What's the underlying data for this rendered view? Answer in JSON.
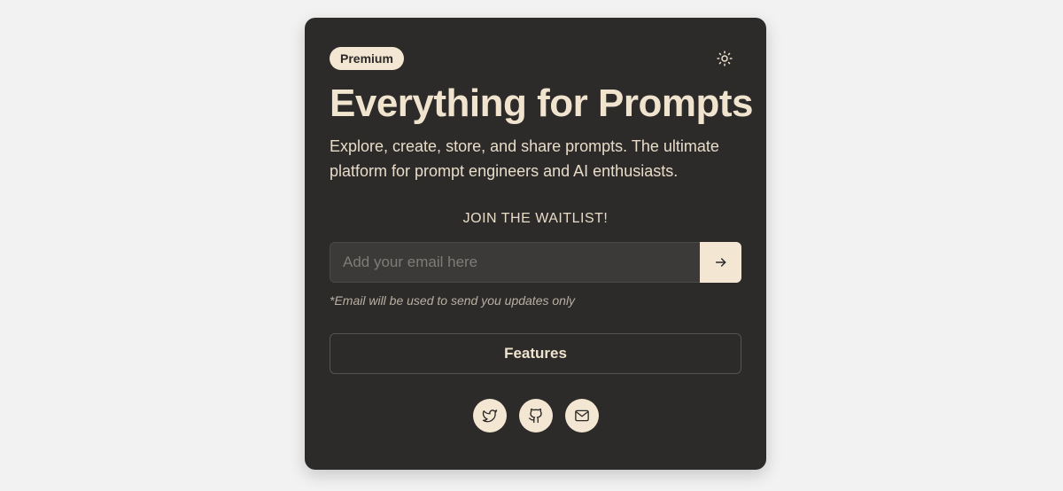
{
  "badge": {
    "label": "Premium"
  },
  "theme_toggle": {
    "icon": "sun-icon"
  },
  "hero": {
    "title": "Everything for Prompts",
    "subtitle": "Explore, create, store, and share prompts. The ultimate platform for prompt engineers and AI enthusiasts."
  },
  "waitlist": {
    "heading": "JOIN THE WAITLIST!",
    "email_value": "",
    "email_placeholder": "Add your email here",
    "submit_icon": "arrow-right-icon",
    "note": "*Email will be used to send you updates only"
  },
  "features_button": {
    "label": "Features"
  },
  "socials": [
    {
      "icon": "twitter-icon"
    },
    {
      "icon": "github-icon"
    },
    {
      "icon": "mail-icon"
    }
  ],
  "colors": {
    "background": "#f2f2f2",
    "card": "#2c2b29",
    "accent": "#f3e6d2",
    "text": "#efe3cf"
  }
}
